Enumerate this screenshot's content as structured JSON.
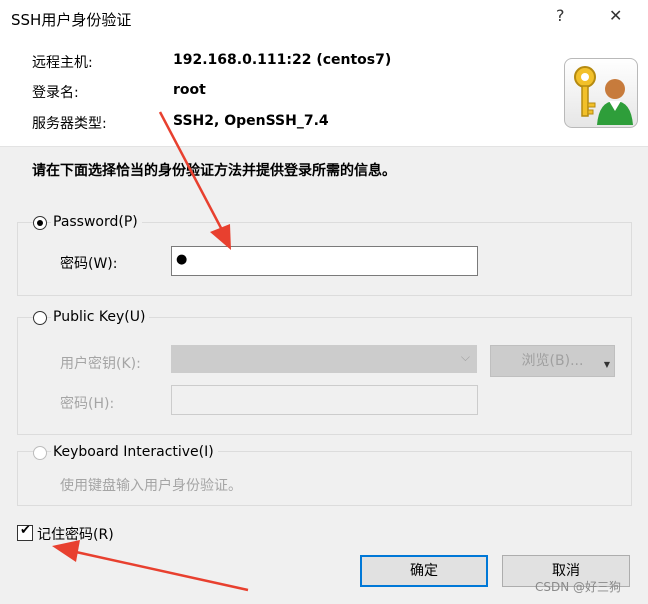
{
  "window": {
    "title": "SSH用户身份验证",
    "help": "?",
    "close": "✕"
  },
  "info": {
    "host_label": "远程主机:",
    "host_value": "192.168.0.111:22 (centos7)",
    "login_label": "登录名:",
    "login_value": "root",
    "server_type_label": "服务器类型:",
    "server_type_value": "SSH2, OpenSSH_7.4"
  },
  "instruction": "请在下面选择恰当的身份验证方法并提供登录所需的信息。",
  "password_group": {
    "label": "Password(P)",
    "field_label": "密码(W):",
    "field_value": "●",
    "selected": true
  },
  "publickey_group": {
    "label": "Public Key(U)",
    "user_key_label": "用户密钥(K):",
    "browse_label": "浏览(B)...",
    "passphrase_label": "密码(H):"
  },
  "keyboard_group": {
    "label": "Keyboard Interactive(I)",
    "description": "使用键盘输入用户身份验证。"
  },
  "remember": {
    "label": "记住密码(R)",
    "checked": true
  },
  "buttons": {
    "ok": "确定",
    "cancel": "取消"
  },
  "watermark": "CSDN @好三狗",
  "colors": {
    "arrow": "#e8402f",
    "focus": "#0078d7"
  }
}
